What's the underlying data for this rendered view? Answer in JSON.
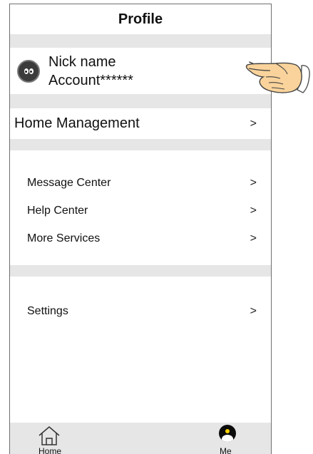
{
  "header": {
    "title": "Profile"
  },
  "profile": {
    "nickname": "Nick name",
    "account": "Account******",
    "arrow": ">"
  },
  "home_management": {
    "label": "Home Management",
    "arrow": ">"
  },
  "menu": [
    {
      "label": "Message Center",
      "arrow": ">"
    },
    {
      "label": "Help Center",
      "arrow": ">"
    },
    {
      "label": "More Services",
      "arrow": ">"
    }
  ],
  "settings": {
    "label": "Settings",
    "arrow": ">"
  },
  "bottom_nav": [
    {
      "label": "Home",
      "icon": "house-icon"
    },
    {
      "label": "Me",
      "icon": "user-avatar-icon"
    }
  ],
  "colors": {
    "section_gray": "#e6e6e6",
    "hand_skin": "#f9d39b"
  }
}
